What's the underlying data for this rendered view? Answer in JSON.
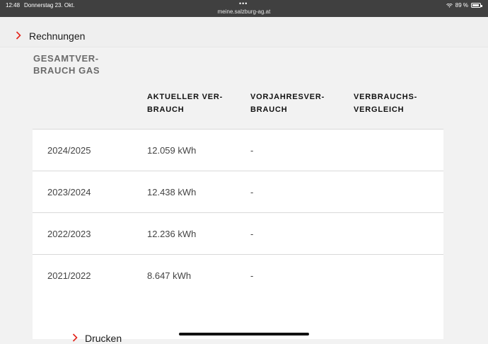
{
  "status_bar": {
    "time": "12:48",
    "date": "Donnerstag 23. Okt.",
    "url": "meine.salzburg-ag.at",
    "battery": "89 %"
  },
  "nav": {
    "invoices_label": "Rechnungen"
  },
  "section": {
    "title_line1": "GESAMTVER-",
    "title_line2": "BRAUCH GAS"
  },
  "table": {
    "headers": [
      {
        "line1": "AKTUELLER VER-",
        "line2": "BRAUCH"
      },
      {
        "line1": "VORJAHRESVER-",
        "line2": "BRAUCH"
      },
      {
        "line1": "VERBRAUCHS-",
        "line2": "VERGLEICH"
      }
    ],
    "rows": [
      {
        "period": "2024/2025",
        "current": "12.059 kWh",
        "previous": "-",
        "comparison": ""
      },
      {
        "period": "2023/2024",
        "current": "12.438 kWh",
        "previous": "-",
        "comparison": ""
      },
      {
        "period": "2022/2023",
        "current": "12.236 kWh",
        "previous": "-",
        "comparison": ""
      },
      {
        "period": "2021/2022",
        "current": "8.647 kWh",
        "previous": "-",
        "comparison": ""
      }
    ]
  },
  "actions": {
    "print_label": "Drucken"
  },
  "colors": {
    "accent": "#e2231a",
    "status_bar_bg": "#404040",
    "page_bg": "#f2f2f2"
  }
}
